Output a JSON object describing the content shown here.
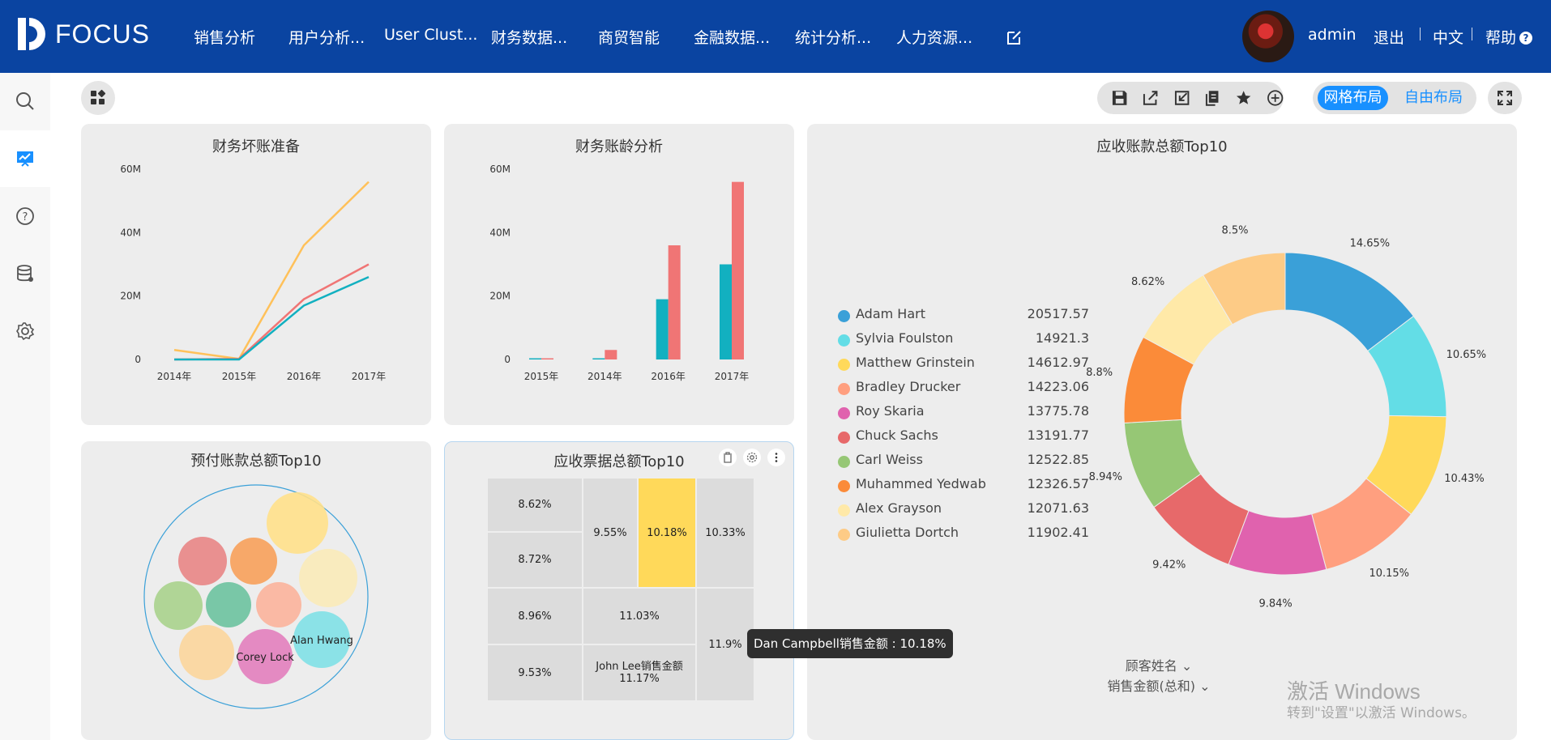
{
  "app": {
    "logo_text": "FOCUS"
  },
  "nav": {
    "items": [
      "销售分析",
      "用户分析...",
      "User Clust...",
      "财务数据...",
      "商贸智能",
      "金融数据...",
      "统计分析...",
      "人力资源..."
    ]
  },
  "user": {
    "name": "admin",
    "logout": "退出",
    "lang": "中文",
    "help": "帮助"
  },
  "layout": {
    "grid": "网格布局",
    "free": "自由布局"
  },
  "charts": {
    "c1": {
      "title": "财务坏账准备"
    },
    "c2": {
      "title": "财务账龄分析"
    },
    "c3": {
      "title": "应收账款总额Top10"
    },
    "c4": {
      "title": "预付账款总额Top10"
    },
    "c5": {
      "title": "应收票据总额Top10"
    }
  },
  "donut_dims": {
    "dim1": "顾客姓名",
    "dim2": "销售金额(总和)"
  },
  "tooltip": "Dan Campbell销售金额 : 10.18%",
  "watermark": {
    "line1": "激活 Windows",
    "line2": "转到\"设置\"以激活 Windows。"
  },
  "icons": [
    "search-icon",
    "chart-board-icon",
    "help-icon",
    "database-icon",
    "settings-icon",
    "save-icon",
    "share-icon",
    "export-icon",
    "copy-icon",
    "star-icon",
    "add-icon",
    "fullscreen-icon",
    "edit-icon",
    "apps-icon",
    "delete-icon",
    "gear-icon",
    "more-icon"
  ],
  "colors": {
    "topbar": "#0a44a1",
    "accent": "#1890ff",
    "teal": "#12b0c0",
    "coral": "#f07575",
    "amber": "#ffc15a"
  },
  "chart_data": [
    {
      "type": "line",
      "title": "财务坏账准备",
      "categories": [
        "2014年",
        "2015年",
        "2016年",
        "2017年"
      ],
      "yticks": [
        "0",
        "20M",
        "40M",
        "60M"
      ],
      "ylim": [
        0,
        60000000
      ],
      "series": [
        {
          "color": "#ffc15a",
          "values": [
            3000000,
            200000,
            36000000,
            56000000
          ]
        },
        {
          "color": "#f07575",
          "values": [
            0,
            200000,
            19000000,
            30000000
          ]
        },
        {
          "color": "#12b0c0",
          "values": [
            0,
            0,
            17000000,
            26000000
          ]
        }
      ]
    },
    {
      "type": "bar",
      "title": "财务账龄分析",
      "categories": [
        "2015年",
        "2014年",
        "2016年",
        "2017年"
      ],
      "yticks": [
        "0",
        "20M",
        "40M",
        "60M"
      ],
      "ylim": [
        0,
        60000000
      ],
      "series": [
        {
          "color": "#12b0c0",
          "values": [
            200000,
            0,
            19000000,
            30000000
          ]
        },
        {
          "color": "#f07575",
          "values": [
            200000,
            3000000,
            36000000,
            56000000
          ]
        }
      ]
    },
    {
      "type": "pie",
      "title": "应收账款总额Top10",
      "legend": "left",
      "slices": [
        {
          "name": "Adam Hart",
          "value": 20517.57,
          "label": "14.65%",
          "color": "#3aa0d8"
        },
        {
          "name": "Sylvia Foulston",
          "value": 14921.3,
          "label": "10.65%",
          "color": "#63dde6"
        },
        {
          "name": "Matthew Grinstein",
          "value": 14612.97,
          "label": "10.43%",
          "color": "#ffd95a"
        },
        {
          "name": "Bradley Drucker",
          "value": 14223.06,
          "label": "10.15%",
          "color": "#ff9f7f"
        },
        {
          "name": "Roy Skaria",
          "value": 13775.78,
          "label": "9.84%",
          "color": "#e062ae"
        },
        {
          "name": "Chuck Sachs",
          "value": 13191.77,
          "label": "9.42%",
          "color": "#e7696a"
        },
        {
          "name": "Carl Weiss",
          "value": 12522.85,
          "label": "8.94%",
          "color": "#96c775"
        },
        {
          "name": "Muhammed Yedwab",
          "value": 12326.57,
          "label": "8.8%",
          "color": "#fb8b39"
        },
        {
          "name": "Alex Grayson",
          "value": 12071.63,
          "label": "8.62%",
          "color": "#ffe9a8"
        },
        {
          "name": "Giulietta Dortch",
          "value": 11902.41,
          "label": "8.5%",
          "color": "#fdcb86"
        }
      ]
    },
    {
      "type": "scatter",
      "title": "预付账款总额Top10",
      "bubbles": [
        {
          "color": "#ffe08a",
          "label": ""
        },
        {
          "color": "#e88585",
          "label": ""
        },
        {
          "color": "#f7a05a",
          "label": ""
        },
        {
          "color": "#faeab8",
          "label": ""
        },
        {
          "color": "#a8d18c",
          "label": ""
        },
        {
          "color": "#6cc29e",
          "label": ""
        },
        {
          "color": "#fbb29b",
          "label": ""
        },
        {
          "color": "#7fe0e6",
          "label": "Alan Hwang"
        },
        {
          "color": "#fbd59b",
          "label": ""
        },
        {
          "color": "#e27ebd",
          "label": "Corey Lock"
        }
      ]
    },
    {
      "type": "treemap",
      "title": "应收票据总额Top10",
      "cells": [
        {
          "label": "8.62%",
          "value": 8.62
        },
        {
          "label": "8.72%",
          "value": 8.72
        },
        {
          "label": "9.55%",
          "value": 9.55
        },
        {
          "label": "10.18%",
          "value": 10.18,
          "highlight": true
        },
        {
          "label": "10.33%",
          "value": 10.33
        },
        {
          "label": "8.96%",
          "value": 8.96
        },
        {
          "label": "9.53%",
          "value": 9.53
        },
        {
          "label": "11.03%",
          "value": 11.03
        },
        {
          "name": "John Lee销售金额",
          "label": "11.17%",
          "value": 11.17
        },
        {
          "label": "11.9%",
          "value": 11.9
        }
      ]
    }
  ]
}
